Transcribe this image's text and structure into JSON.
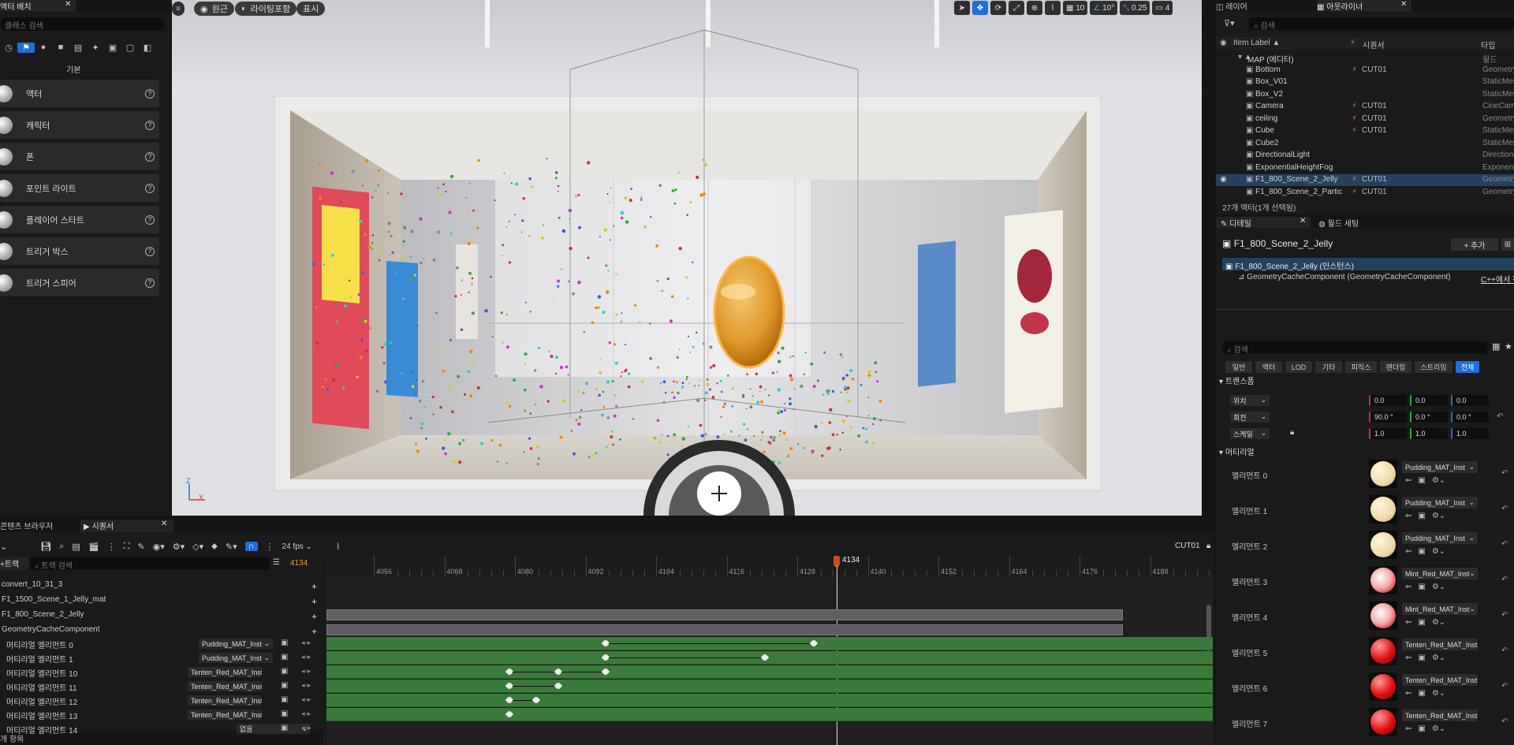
{
  "place_actors": {
    "tab_label": "액터 배치",
    "search_placeholder": "클래스 검색",
    "category": "기본",
    "items": [
      "액터",
      "캐릭터",
      "폰",
      "포인트 라이트",
      "플레이어 스타트",
      "트리거 박스",
      "트리거 스피어"
    ]
  },
  "viewport": {
    "perspective_label": "원근",
    "lit_label": "라이팅포함",
    "show_label": "표시",
    "grid_snap": "10",
    "angle_snap": "10°",
    "scale_snap": "0.25",
    "camera_speed": "4"
  },
  "outliner": {
    "layers_tab": "레이어",
    "outliner_tab": "아웃라이너",
    "search_placeholder": "검색",
    "col_label": "Item Label ▲",
    "col_seq": "시퀀서",
    "col_type": "타입",
    "rows": [
      {
        "name": "MAP (에디터)",
        "seq": "",
        "type": "월드"
      },
      {
        "name": "Bottom",
        "seq": "CUT01",
        "type": "GeometryC"
      },
      {
        "name": "Box_V01",
        "seq": "",
        "type": "StaticMes"
      },
      {
        "name": "Box_V2",
        "seq": "",
        "type": "StaticMes"
      },
      {
        "name": "Camera",
        "seq": "CUT01",
        "type": "CineCam"
      },
      {
        "name": "ceiling",
        "seq": "CUT01",
        "type": "GeometryC"
      },
      {
        "name": "Cube",
        "seq": "CUT01",
        "type": "StaticMes"
      },
      {
        "name": "Cube2",
        "seq": "",
        "type": "StaticMes"
      },
      {
        "name": "DirectionalLight",
        "seq": "",
        "type": "Directiona"
      },
      {
        "name": "ExponentialHeightFog",
        "seq": "",
        "type": "Exponent"
      },
      {
        "name": "F1_800_Scene_2_Jelly",
        "seq": "CUT01",
        "type": "GeometryC"
      },
      {
        "name": "F1_800_Scene_2_Partic",
        "seq": "CUT01",
        "type": "GeometryC"
      }
    ],
    "status": "27개 액터(1개 선택됨)"
  },
  "details": {
    "details_tab": "디테일",
    "world_tab": "월드 세팅",
    "actor_name": "F1_800_Scene_2_Jelly",
    "add_label": "+ 추가",
    "instance_label": "F1_800_Scene_2_Jelly (인스턴스)",
    "component_label": "GeometryCacheComponent (GeometryCacheComponent)",
    "cpp_link": "C++에서 편",
    "search_placeholder": "검색",
    "categories": [
      "일반",
      "액터",
      "LOD",
      "기타",
      "피직스",
      "렌더링",
      "스트리밍",
      "전체"
    ],
    "transform_label": "트랜스폼",
    "location_label": "위치",
    "rotation_label": "회전",
    "scale_label": "스케일",
    "location": [
      "0.0",
      "0.0",
      "0.0"
    ],
    "rotation": [
      "90.0 °",
      "0.0 °",
      "0.0 °"
    ],
    "scale": [
      "1.0",
      "1.0",
      "1.0"
    ],
    "materials_label": "머티리얼",
    "materials": [
      {
        "label": "엘리먼트 0",
        "mat": "Pudding_MAT_Inst",
        "kind": "pudding"
      },
      {
        "label": "엘리먼트 1",
        "mat": "Pudding_MAT_Inst",
        "kind": "pudding"
      },
      {
        "label": "엘리먼트 2",
        "mat": "Pudding_MAT_Inst",
        "kind": "pudding"
      },
      {
        "label": "엘리먼트 3",
        "mat": "Mint_Red_MAT_Inst",
        "kind": "mint"
      },
      {
        "label": "엘리먼트 4",
        "mat": "Mint_Red_MAT_Inst",
        "kind": "mint"
      },
      {
        "label": "엘리먼트 5",
        "mat": "Tenten_Red_MAT_Inst",
        "kind": "tenten"
      },
      {
        "label": "엘리먼트 6",
        "mat": "Tenten_Red_MAT_Inst",
        "kind": "tenten"
      },
      {
        "label": "엘리먼트 7",
        "mat": "Tenten_Red_MAT_Inst",
        "kind": "tenten"
      }
    ]
  },
  "sequencer": {
    "content_tab": "콘텐츠 브라우저",
    "seq_tab": "시퀀서",
    "fps": "24 fps",
    "cut_name": "CUT01",
    "track_label": "트랙",
    "track_search_placeholder": "트랙 검색",
    "current_frame": "4134",
    "ticks": [
      "4056",
      "4068",
      "4080",
      "4092",
      "4104",
      "4116",
      "4128",
      "4140",
      "4152",
      "4164",
      "4176",
      "4188"
    ],
    "tracks": [
      {
        "name": "convert_10_31_3",
        "mat": ""
      },
      {
        "name": "F1_1500_Scene_1_Jelly_mat",
        "mat": ""
      },
      {
        "name": "F1_800_Scene_2_Jelly",
        "mat": ""
      },
      {
        "name": "GeometryCacheComponent",
        "mat": ""
      },
      {
        "name": "머티리얼 엘리먼트 0",
        "mat": "Pudding_MAT_Inst"
      },
      {
        "name": "머티리얼 엘리먼트 1",
        "mat": "Pudding_MAT_Inst"
      },
      {
        "name": "머티리얼 엘리먼트 10",
        "mat": "Tenten_Red_MAT_Inst"
      },
      {
        "name": "머티리얼 엘리먼트 11",
        "mat": "Tenten_Red_MAT_Inst"
      },
      {
        "name": "머티리얼 엘리먼트 12",
        "mat": "Tenten_Red_MAT_Inst"
      },
      {
        "name": "머티리얼 엘리먼트 13",
        "mat": "Tenten_Red_MAT_Inst"
      },
      {
        "name": "머티리얼 엘리먼트 14",
        "mat": "없음"
      }
    ],
    "footer_count": "개 항목"
  }
}
